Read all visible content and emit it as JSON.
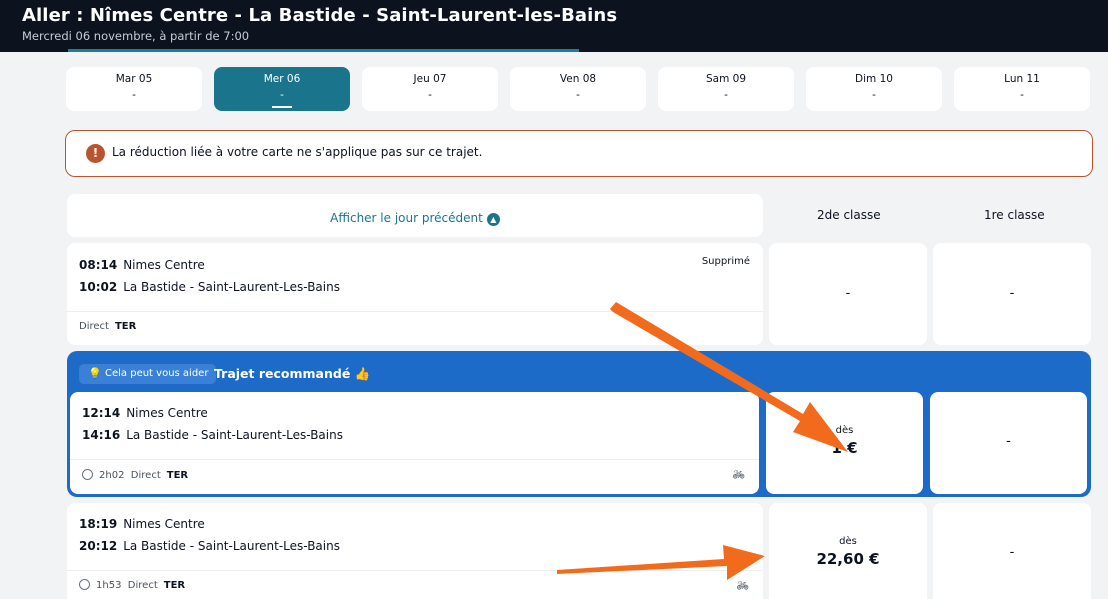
{
  "header": {
    "title": "Aller : Nîmes Centre - La Bastide - Saint-Laurent-les-Bains",
    "subtitle": "Mercredi 06 novembre, à partir de 7:00"
  },
  "dates": [
    {
      "label": "Mar 05",
      "price": "-",
      "active": false
    },
    {
      "label": "Mer 06",
      "price": "-",
      "active": true
    },
    {
      "label": "Jeu 07",
      "price": "-",
      "active": false
    },
    {
      "label": "Ven 08",
      "price": "-",
      "active": false
    },
    {
      "label": "Sam 09",
      "price": "-",
      "active": false
    },
    {
      "label": "Dim 10",
      "price": "-",
      "active": false
    },
    {
      "label": "Lun 11",
      "price": "-",
      "active": false
    }
  ],
  "alert": {
    "icon": "exclamation-icon",
    "text": "La réduction liée à votre carte ne s'applique pas sur ce trajet."
  },
  "previous_day": {
    "label": "Afficher le jour précédent",
    "icon": "chevron-up-icon"
  },
  "class_headers": {
    "second": "2de classe",
    "first": "1re classe"
  },
  "recommended": {
    "help_label": "Cela peut vous aider",
    "title": "Trajet recommandé",
    "emoji": "👍"
  },
  "trips": [
    {
      "dep_time": "08:14",
      "dep_station": "Nimes Centre",
      "arr_time": "10:02",
      "arr_station": "La Bastide - Saint-Laurent-Les-Bains",
      "duration": "",
      "type": "Direct",
      "train": "TER",
      "status": "Supprimé",
      "second_class": {
        "prefix": "",
        "price": "-"
      },
      "first_class": {
        "prefix": "",
        "price": "-"
      }
    },
    {
      "dep_time": "12:14",
      "dep_station": "Nimes Centre",
      "arr_time": "14:16",
      "arr_station": "La Bastide - Saint-Laurent-Les-Bains",
      "duration": "2h02",
      "type": "Direct",
      "train": "TER",
      "status": "",
      "second_class": {
        "prefix": "dès",
        "price": "1 €"
      },
      "first_class": {
        "prefix": "",
        "price": "-"
      }
    },
    {
      "dep_time": "18:19",
      "dep_station": "Nimes Centre",
      "arr_time": "20:12",
      "arr_station": "La Bastide - Saint-Laurent-Les-Bains",
      "duration": "1h53",
      "type": "Direct",
      "train": "TER",
      "status": "",
      "second_class": {
        "prefix": "dès",
        "price": "22,60 €"
      },
      "first_class": {
        "prefix": "",
        "price": "-"
      }
    }
  ],
  "annotation": {
    "arrow_color": "#f26b1d"
  },
  "colors": {
    "header_bg": "#0c131f",
    "accent_teal": "#1a758c",
    "reco_blue": "#1c6bc9",
    "alert_border": "#b9552e"
  }
}
